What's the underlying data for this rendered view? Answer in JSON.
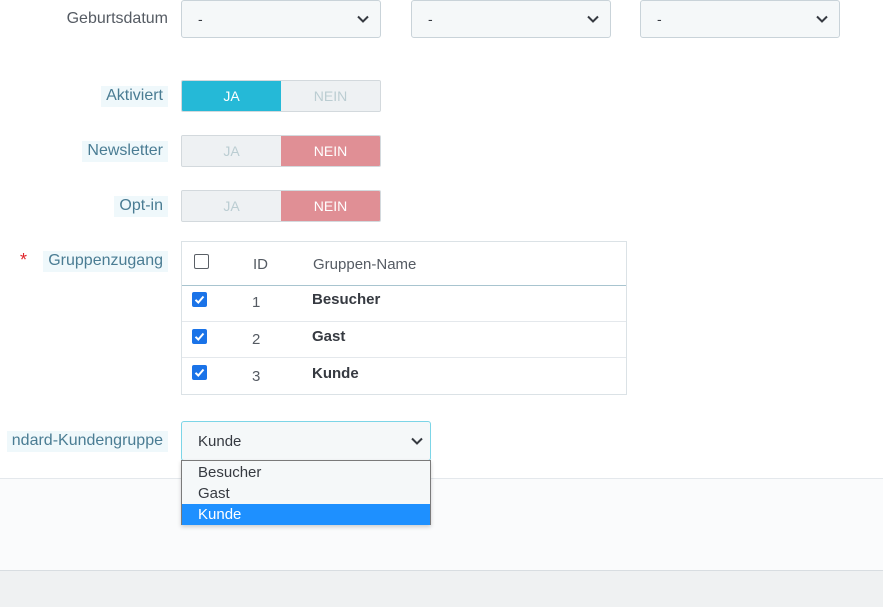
{
  "birthdate": {
    "label": "Geburtsdatum",
    "day": "-",
    "month": "-",
    "year": "-"
  },
  "activated": {
    "label": "Aktiviert",
    "yes": "JA",
    "no": "NEIN",
    "value": "JA"
  },
  "newsletter": {
    "label": "Newsletter",
    "yes": "JA",
    "no": "NEIN",
    "value": "NEIN"
  },
  "optin": {
    "label": "Opt-in",
    "yes": "JA",
    "no": "NEIN",
    "value": "NEIN"
  },
  "group_access": {
    "label": "Gruppenzugang",
    "required_mark": "*",
    "columns": [
      "ID",
      "Gruppen-Name"
    ],
    "header_checked": false,
    "rows": [
      {
        "id": "1",
        "name": "Besucher",
        "checked": true
      },
      {
        "id": "2",
        "name": "Gast",
        "checked": true
      },
      {
        "id": "3",
        "name": "Kunde",
        "checked": true
      }
    ]
  },
  "default_group": {
    "label": "ndard-Kundengruppe",
    "value": "Kunde",
    "options": [
      "Besucher",
      "Gast",
      "Kunde"
    ],
    "highlighted": "Kunde"
  },
  "colors": {
    "accent": "#25b9d7",
    "no_active": "#e08f95",
    "checkbox": "#1a73e8",
    "dropdown_highlight": "#1e90ff"
  }
}
